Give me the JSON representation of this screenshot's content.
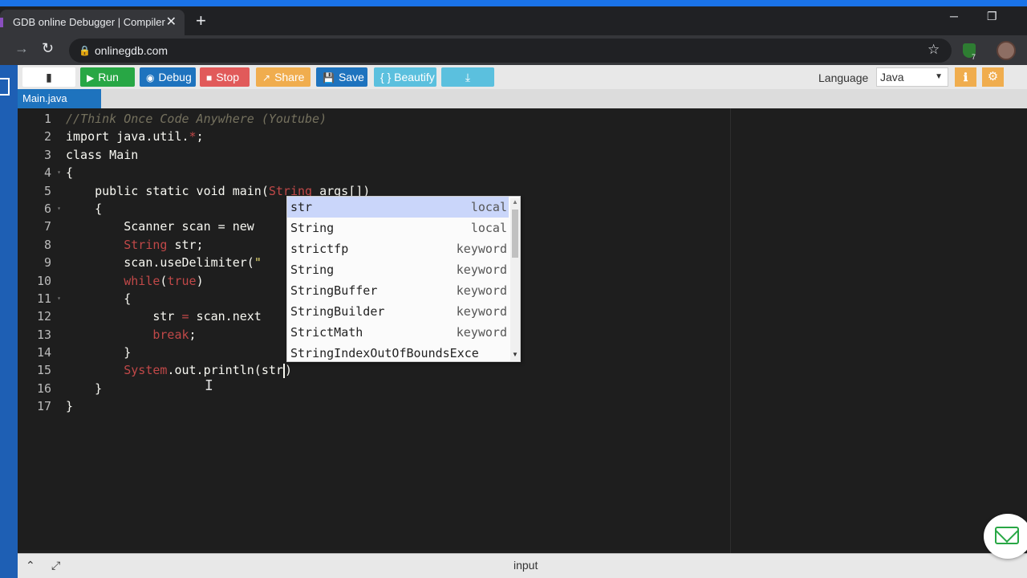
{
  "browser": {
    "tab_title": "GDB online Debugger | Compiler",
    "tab_close": "✕",
    "new_tab": "+",
    "url": "onlinegdb.com",
    "extension_badge": "7"
  },
  "toolbar": {
    "run_label": "Run",
    "debug_label": "Debug",
    "stop_label": "Stop",
    "share_label": "Share",
    "save_label": "Save",
    "beautify_label": "{ } Beautify",
    "language_label": "Language",
    "language_value": "Java"
  },
  "file_tabs": [
    "Main.java"
  ],
  "editor": {
    "line_numbers": [
      "1",
      "2",
      "3",
      "4",
      "5",
      "6",
      "7",
      "8",
      "9",
      "10",
      "11",
      "12",
      "13",
      "14",
      "15",
      "16",
      "17"
    ]
  },
  "autocomplete": {
    "items": [
      {
        "name": "str",
        "meta": "local"
      },
      {
        "name": "String",
        "meta": "local"
      },
      {
        "name": "strictfp",
        "meta": "keyword"
      },
      {
        "name": "String",
        "meta": "keyword"
      },
      {
        "name": "StringBuffer",
        "meta": "keyword"
      },
      {
        "name": "StringBuilder",
        "meta": "keyword"
      },
      {
        "name": "StrictMath",
        "meta": "keyword"
      },
      {
        "name": "StringIndexOutOfBoundsExce",
        "meta": ""
      }
    ]
  },
  "bottom_panel": {
    "label": "input"
  },
  "colors": {
    "run": "#28a745",
    "debug": "#1e73be",
    "stop": "#e15a5a",
    "share": "#f0ad4e",
    "editor_bg": "#1e1e1e"
  }
}
